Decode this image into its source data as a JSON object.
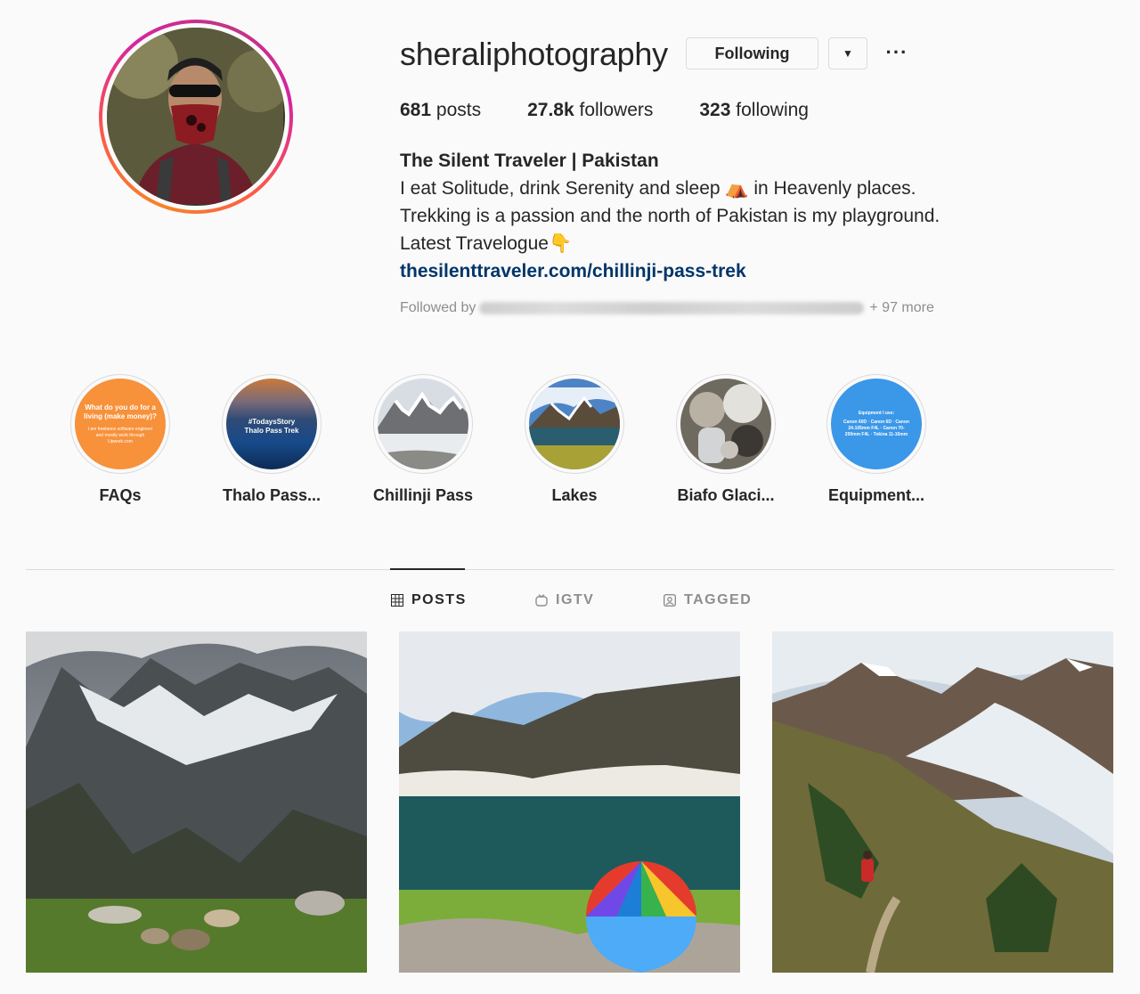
{
  "profile": {
    "username": "sheraliphotography",
    "follow_button": "Following",
    "dropdown_icon": "chevron-down-icon",
    "more_icon": "more-options-icon",
    "stats": {
      "posts_count": "681",
      "posts_label": "posts",
      "followers_count": "27.8k",
      "followers_label": "followers",
      "following_count": "323",
      "following_label": "following"
    },
    "bio": {
      "name": "The Silent Traveler | Pakistan",
      "line1": "I eat Solitude, drink Serenity and sleep ⛺ in Heavenly places.",
      "line2": "Trekking is a passion and the north of Pakistan is my playground.",
      "line3": "Latest Travelogue👇",
      "link": "thesilenttraveler.com/chillinji-pass-trek"
    },
    "followed_by": {
      "label": "Followed by",
      "more": "+ 97 more"
    }
  },
  "highlights": [
    {
      "label": "FAQs",
      "title": "What do you do for a living (make money)?",
      "body": "I am freelance software engineer and mostly work through Upwork.com",
      "color": "#f7913a"
    },
    {
      "label": "Thalo Pass...",
      "title": "#TodaysStory",
      "body": "Thalo Pass Trek",
      "color": "#1f3d66"
    },
    {
      "label": "Chillinji Pass"
    },
    {
      "label": "Lakes"
    },
    {
      "label": "Biafo Glaci..."
    },
    {
      "label": "Equipment...",
      "title": "Equipment I use:",
      "body": "Canon 60D · Canon 6D · Canon 24-105mm F4L · Canon 70-200mm F4L · Tokina 11-16mm",
      "color": "#3b97e8"
    }
  ],
  "tabs": [
    {
      "label": "POSTS",
      "icon": "grid-icon",
      "active": true
    },
    {
      "label": "IGTV",
      "icon": "igtv-icon",
      "active": false
    },
    {
      "label": "TAGGED",
      "icon": "tagged-icon",
      "active": false
    }
  ],
  "colors": {
    "link": "#003569",
    "text": "#262626",
    "muted": "#8e8e8e",
    "border": "#dbdbdb"
  }
}
